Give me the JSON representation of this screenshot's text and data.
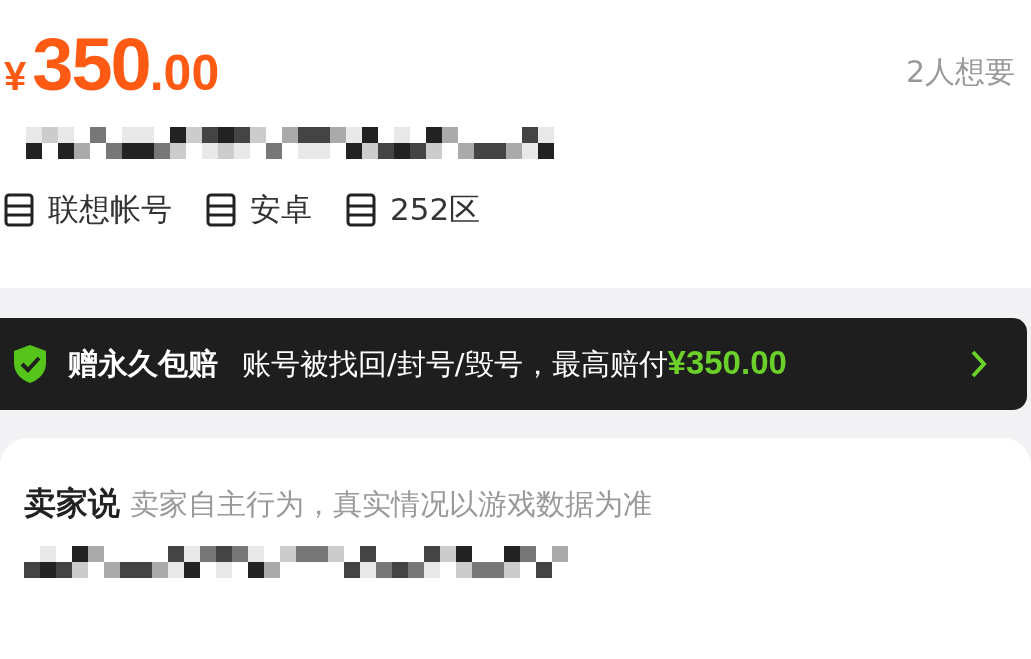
{
  "price": {
    "currency": "¥",
    "integer": "350",
    "decimal": ".00"
  },
  "wanted": "2人想要",
  "tags": [
    "联想帐号",
    "安卓",
    "252区"
  ],
  "guarantee": {
    "title": "赠永久包赔",
    "text": "账号被找回/封号/毁号，最高赔付",
    "amount": "¥350.00"
  },
  "seller": {
    "title": "卖家说",
    "note": "卖家自主行为，真实情况以游戏数据为准"
  }
}
